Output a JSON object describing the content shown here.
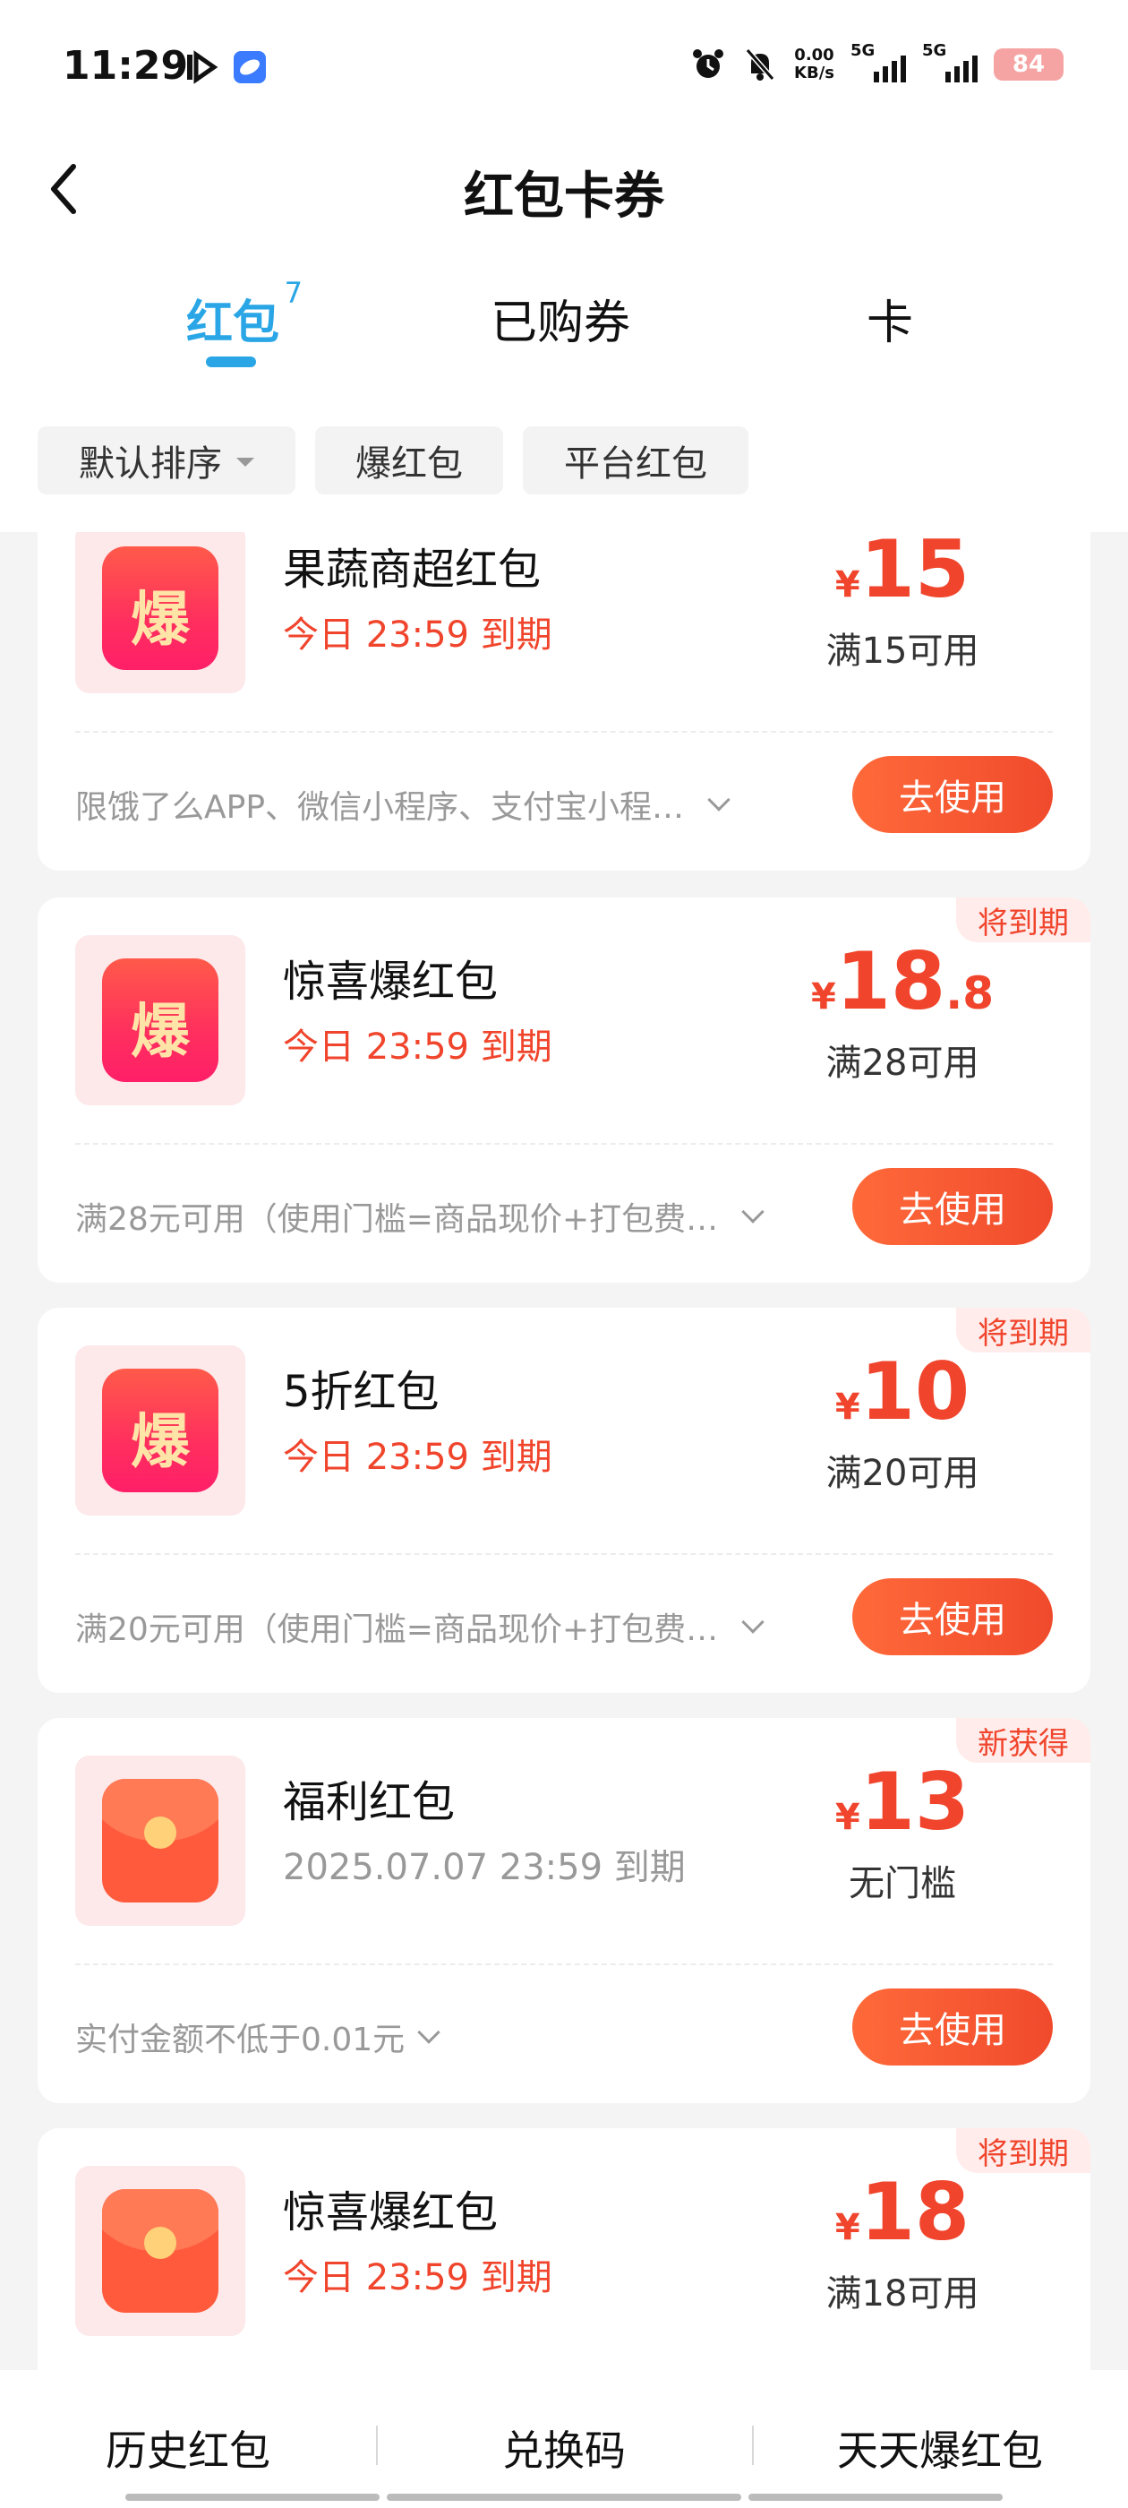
{
  "status_bar": {
    "time": "11:29",
    "net_speed_value": "0.00",
    "net_speed_unit": "KB/s",
    "sim1": "5G",
    "sim2": "5G",
    "battery": "84"
  },
  "header": {
    "title": "红包卡券"
  },
  "tabs": [
    {
      "label": "红包",
      "count": "7",
      "active": true
    },
    {
      "label": "已购券",
      "active": false
    },
    {
      "label": "卡",
      "active": false
    }
  ],
  "filters": [
    {
      "label": "默认排序"
    },
    {
      "label": "爆红包"
    },
    {
      "label": "平台红包"
    }
  ],
  "cards": [
    {
      "icon": "bao-icon",
      "icon_text": "爆",
      "title": "果蔬商超红包",
      "expiry": "今日 23:59 到期",
      "amount_symbol": "¥",
      "amount": "15",
      "amount_decimal": "",
      "threshold": "满15可用",
      "description": "限饿了么APP、微信小程序、支付宝小程…",
      "button": "去使用",
      "badge": ""
    },
    {
      "icon": "bao-icon",
      "icon_text": "爆",
      "title": "惊喜爆红包",
      "expiry": "今日 23:59 到期",
      "amount_symbol": "¥",
      "amount": "18",
      "amount_decimal": ".8",
      "threshold": "满28可用",
      "description": "满28元可用（使用门槛=商品现价+打包费…",
      "button": "去使用",
      "badge": "将到期"
    },
    {
      "icon": "bao-icon",
      "icon_text": "爆",
      "title": "5折红包",
      "expiry": "今日 23:59 到期",
      "amount_symbol": "¥",
      "amount": "10",
      "amount_decimal": "",
      "threshold": "满20可用",
      "description": "满20元可用（使用门槛=商品现价+打包费…",
      "button": "去使用",
      "badge": "将到期"
    },
    {
      "icon": "red-envelope-icon",
      "icon_text": "",
      "title": "福利红包",
      "expiry": "2025.07.07 23:59 到期",
      "amount_symbol": "¥",
      "amount": "13",
      "amount_decimal": "",
      "threshold": "无门槛",
      "description": "实付金额不低于0.01元",
      "button": "去使用",
      "badge": "新获得"
    },
    {
      "icon": "red-envelope-icon",
      "icon_text": "",
      "title": "惊喜爆红包",
      "expiry": "今日 23:59 到期",
      "amount_symbol": "¥",
      "amount": "18",
      "amount_decimal": "",
      "threshold": "满18可用",
      "description": "",
      "button": "去使用",
      "badge": "将到期"
    }
  ],
  "bottom_bar": [
    {
      "label": "历史红包"
    },
    {
      "label": "兑换码"
    },
    {
      "label": "天天爆红包"
    }
  ],
  "colors": {
    "accent_blue": "#2aa6e6",
    "accent_red": "#f0452c"
  }
}
